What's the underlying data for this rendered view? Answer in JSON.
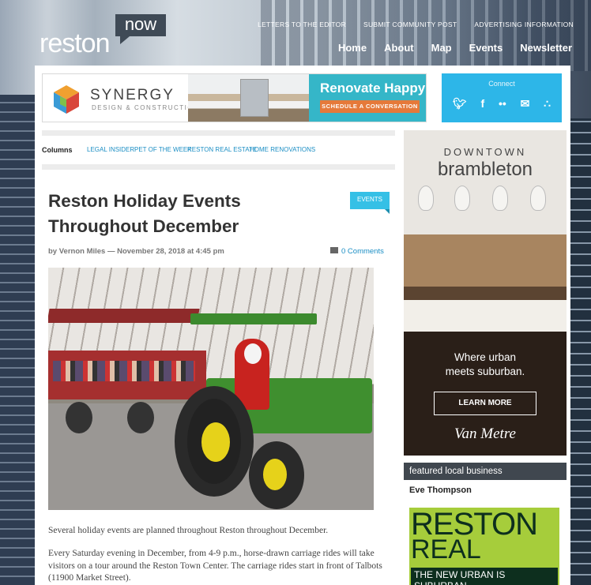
{
  "brand": {
    "name": "reston",
    "bubble": "now"
  },
  "top_links": [
    "LETTERS TO THE EDITOR",
    "SUBMIT COMMUNITY POST",
    "ADVERTISING INFORMATION"
  ],
  "main_nav": [
    "Home",
    "About",
    "Map",
    "Events",
    "Newsletter"
  ],
  "banner": {
    "company": "SYNERGY",
    "company_sub": "DESIGN & CONSTRUCTION",
    "headline": "Renovate Happy",
    "cta": "SCHEDULE A CONVERSATION"
  },
  "connect": {
    "label": "Connect",
    "icons": [
      "twitter-icon",
      "facebook-icon",
      "flickr-icon",
      "email-icon",
      "rss-icon"
    ]
  },
  "columns": {
    "label": "Columns",
    "links": [
      "LEGAL INSIDER",
      "PET OF THE WEEK",
      "RESTON REAL ESTATE",
      "HOME RENOVATIONS"
    ]
  },
  "article": {
    "title": "Reston Holiday Events Throughout December",
    "category": "EVENTS",
    "byline": "by Vernon Miles — November 28, 2018 at 4:45 pm",
    "comments": "0 Comments",
    "p1": "Several holiday events are planned throughout Reston throughout December.",
    "p2": "Every Saturday evening in December, from 4-9 p.m., horse-drawn carriage rides will take visitors on a tour around the Reston Town Center. The carriage rides start in front of Talbots (11900 Market Street)."
  },
  "sidebar_ad": {
    "downtown": "DOWNTOWN",
    "brand": "brambleton",
    "line1": "Where urban",
    "line2": "meets suburban.",
    "button": "LEARN MORE",
    "logo": "Van Metre"
  },
  "featured": {
    "header": "featured local business",
    "name": "Eve Thompson",
    "ad_line1": "RESTON",
    "ad_line2": "REAL ESTATE",
    "ad_line3": "THE NEW URBAN IS SUBURBAN"
  },
  "colors": {
    "accent": "#35c0e6",
    "connect": "#2db6e8",
    "cta": "#e5793a",
    "realestate": "#a6cd3b"
  }
}
